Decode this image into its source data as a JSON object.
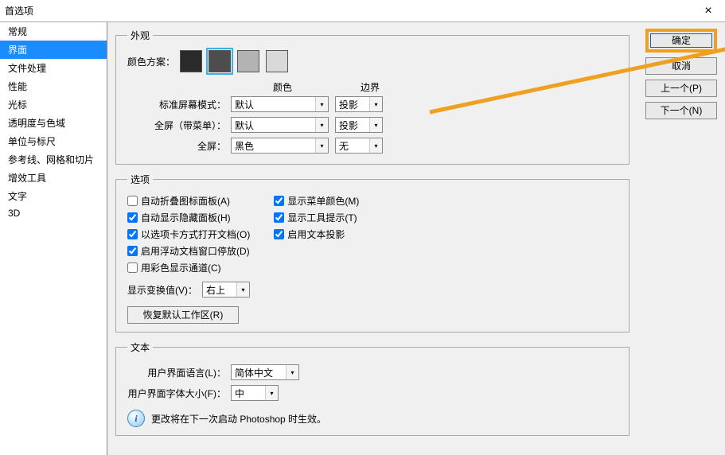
{
  "window": {
    "title": "首选项"
  },
  "sidebar": {
    "items": [
      {
        "label": "常规"
      },
      {
        "label": "界面",
        "selected": true
      },
      {
        "label": "文件处理"
      },
      {
        "label": "性能"
      },
      {
        "label": "光标"
      },
      {
        "label": "透明度与色域"
      },
      {
        "label": "单位与标尺"
      },
      {
        "label": "参考线、网格和切片"
      },
      {
        "label": "增效工具"
      },
      {
        "label": "文字"
      },
      {
        "label": "3D"
      }
    ]
  },
  "buttons": {
    "ok": "确定",
    "cancel": "取消",
    "prev": "上一个(P)",
    "next": "下一个(N)"
  },
  "appearance": {
    "legend": "外观",
    "color_scheme_label": "颜色方案：",
    "swatches": [
      {
        "color": "#2a2a2a"
      },
      {
        "color": "#4d4d4d",
        "active": true
      },
      {
        "color": "#b3b3b3"
      },
      {
        "color": "#d9d9d9"
      }
    ],
    "head_color": "颜色",
    "head_border": "边界",
    "rows": [
      {
        "label": "标准屏幕模式：",
        "color": "默认",
        "border": "投影"
      },
      {
        "label": "全屏（带菜单）：",
        "color": "默认",
        "border": "投影"
      },
      {
        "label": "全屏：",
        "color": "黑色",
        "border": "无"
      }
    ]
  },
  "options": {
    "legend": "选项",
    "left": [
      {
        "label": "自动折叠图标面板(A)",
        "checked": false
      },
      {
        "label": "自动显示隐藏面板(H)",
        "checked": true
      },
      {
        "label": "以选项卡方式打开文档(O)",
        "checked": true
      },
      {
        "label": "启用浮动文档窗口停放(D)",
        "checked": true
      },
      {
        "label": "用彩色显示通道(C)",
        "checked": false
      }
    ],
    "right": [
      {
        "label": "显示菜单颜色(M)",
        "checked": true
      },
      {
        "label": "显示工具提示(T)",
        "checked": true
      },
      {
        "label": "启用文本投影",
        "checked": true
      }
    ],
    "show_transform_label": "显示变换值(V)：",
    "show_transform_value": "右上",
    "restore": "恢复默认工作区(R)"
  },
  "text": {
    "legend": "文本",
    "ui_lang_label": "用户界面语言(L)：",
    "ui_lang_value": "简体中文",
    "ui_font_label": "用户界面字体大小(F)：",
    "ui_font_value": "中",
    "info": "更改将在下一次启动 Photoshop 时生效。"
  }
}
